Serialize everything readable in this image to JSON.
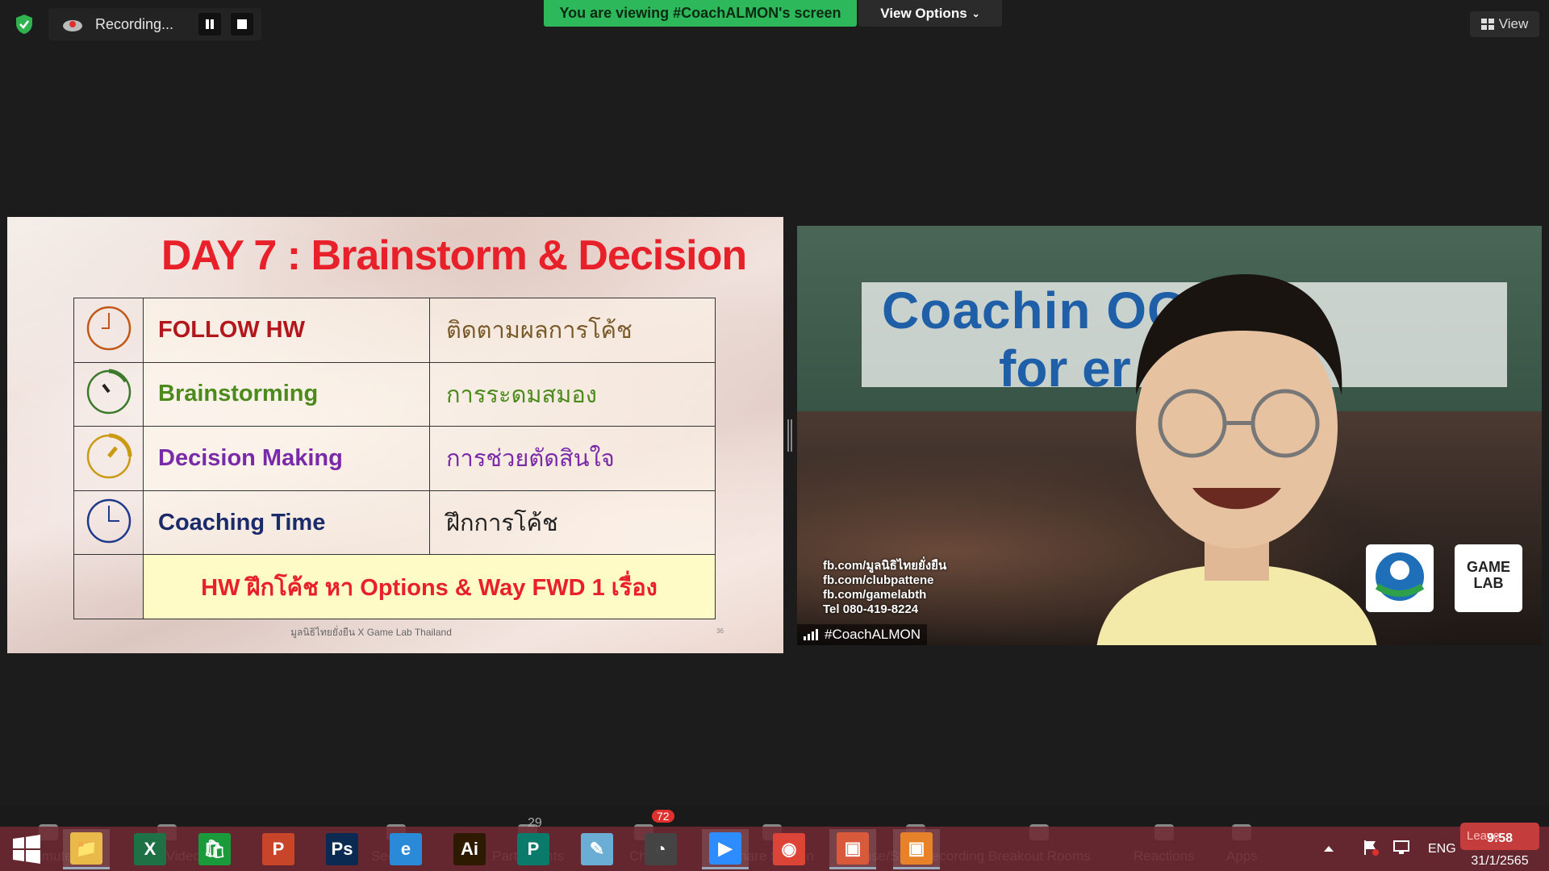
{
  "meeting_bar": {
    "recording_label": "Recording...",
    "viewing_banner": "You are viewing #CoachALMON's screen",
    "view_options_label": "View Options",
    "view_label": "View"
  },
  "slide": {
    "title": "DAY 7 : Brainstorm & Decision",
    "rows": [
      {
        "en": "FOLLOW HW",
        "th": "ติดตามผลการโค้ช",
        "en_color": "#b2171c",
        "th_color": "#7a5a2a",
        "icon_color": "#c0581a"
      },
      {
        "en": "Brainstorming",
        "th": "การระดมสมอง",
        "en_color": "#4c8a1c",
        "th_color": "#4c8a1c",
        "icon_color": "#3a7a2a"
      },
      {
        "en": "Decision Making",
        "th": "การช่วยตัดสินใจ",
        "en_color": "#7a2aa8",
        "th_color": "#7a2aa8",
        "icon_color": "#c99a12"
      },
      {
        "en": "Coaching Time",
        "th": "ฝึกการโค้ช",
        "en_color": "#1a2a6a",
        "th_color": "#222222",
        "icon_color": "#1f3a8a"
      }
    ],
    "homework": "HW ฝึกโค้ช หา Options & Way FWD 1 เรื่อง",
    "footer": "มูลนิธิไทยยั่งยืน X Game Lab Thailand",
    "page_number": "36"
  },
  "video": {
    "participant_name": "#CoachALMON",
    "backdrop_line1": "Coachin      OGRAM",
    "backdrop_line2": "for            er",
    "contact_lines": [
      "fb.com/มูลนิธิไทยยั่งยืน",
      "fb.com/clubpattene",
      "fb.com/gamelabth",
      "Tel 080-419-8224"
    ],
    "logo_right_text": "GAME LAB"
  },
  "zoom_toolbar": {
    "items": [
      {
        "label": "Unmute",
        "icon": "mic-muted-icon"
      },
      {
        "label": "Start Video",
        "icon": "video-off-icon"
      },
      {
        "label": "Security",
        "icon": "shield-icon"
      },
      {
        "label": "Participants",
        "icon": "participants-icon",
        "count": "29"
      },
      {
        "label": "Chat",
        "icon": "chat-icon",
        "badge": "72"
      },
      {
        "label": "Share Screen",
        "icon": "share-screen-icon"
      },
      {
        "label": "Pause/Stop Recording",
        "icon": "pause-stop-icon"
      },
      {
        "label": "Breakout Rooms",
        "icon": "breakout-rooms-icon"
      },
      {
        "label": "Reactions",
        "icon": "reactions-icon"
      },
      {
        "label": "Apps",
        "icon": "apps-icon"
      }
    ],
    "leave_label": "Leave"
  },
  "taskbar": {
    "apps": [
      {
        "name": "File Explorer",
        "glyph": "📁",
        "bg": "#e9b94a"
      },
      {
        "name": "Excel",
        "glyph": "X",
        "bg": "#1e7145"
      },
      {
        "name": "Store",
        "glyph": "🛍",
        "bg": "#1a9a3a"
      },
      {
        "name": "PowerPoint",
        "glyph": "P",
        "bg": "#c8452a"
      },
      {
        "name": "Photoshop",
        "glyph": "Ps",
        "bg": "#0a2a52"
      },
      {
        "name": "Internet Explorer",
        "glyph": "e",
        "bg": "#2a8ad8"
      },
      {
        "name": "Illustrator",
        "glyph": "Ai",
        "bg": "#2e1a00"
      },
      {
        "name": "Publisher",
        "glyph": "P",
        "bg": "#0a7a6a"
      },
      {
        "name": "Notepad",
        "glyph": "✎",
        "bg": "#6aaed6"
      },
      {
        "name": "PhotoScape",
        "glyph": "◔",
        "bg": "#444444"
      },
      {
        "name": "Zoom",
        "glyph": "▶",
        "bg": "#2d8cff"
      },
      {
        "name": "Chrome",
        "glyph": "◉",
        "bg": "#db4437"
      },
      {
        "name": "Photo Viewer",
        "glyph": "▣",
        "bg": "#d85a3a"
      },
      {
        "name": "Photo App",
        "glyph": "▣",
        "bg": "#e8822a"
      }
    ],
    "tray": {
      "language": "ENG",
      "time": "9:58",
      "date": "31/1/2565"
    }
  }
}
